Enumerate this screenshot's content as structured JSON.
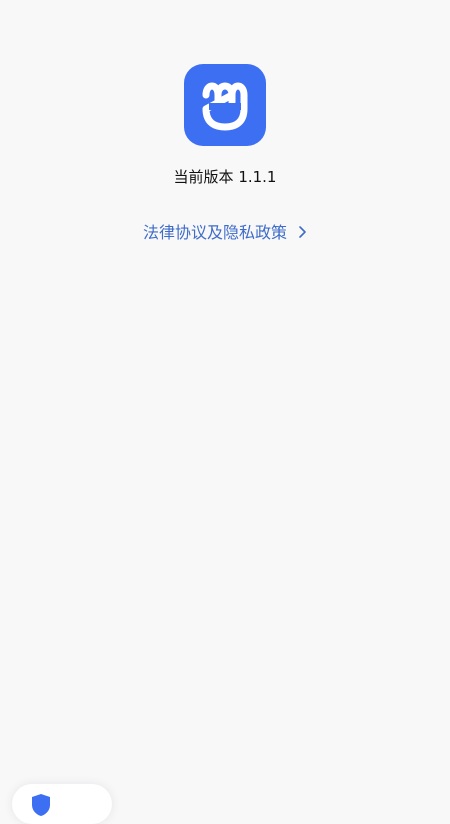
{
  "app": {
    "icon": "smile-m-logo-icon",
    "icon_color": "#3d6ff3"
  },
  "version": {
    "label": "当前版本",
    "number": "1.1.1"
  },
  "legal": {
    "link_label": "法律协议及隐私政策",
    "link_color": "#3f6cc9"
  },
  "floating": {
    "icon": "shield-icon"
  }
}
